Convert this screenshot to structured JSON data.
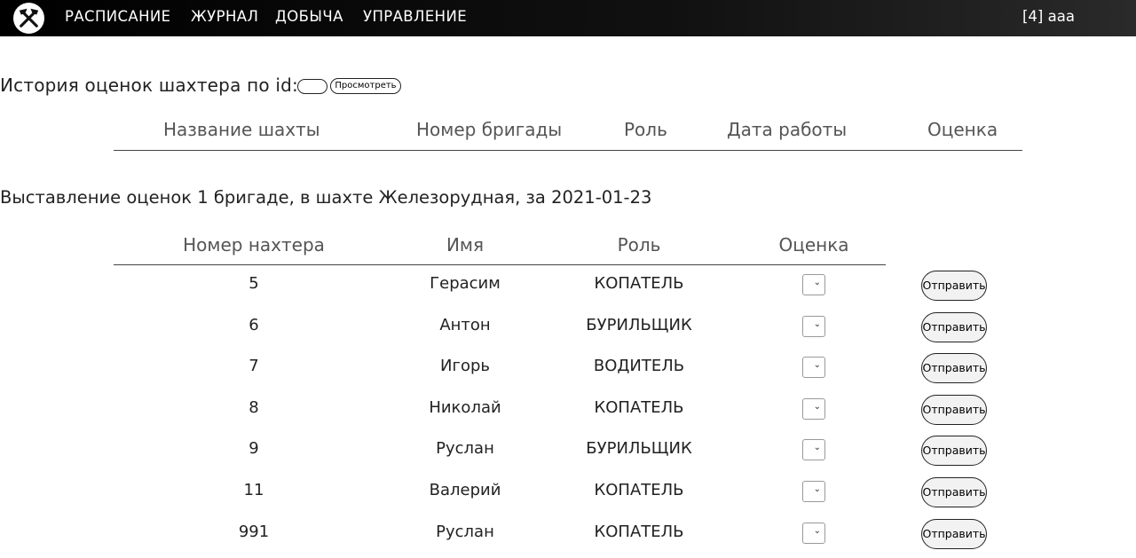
{
  "nav": {
    "items": [
      "РАСПИСАНИЕ",
      "ЖУРНАЛ",
      "ДОБЫЧА",
      "УПРАВЛЕНИЕ"
    ],
    "user": "[4] aaa"
  },
  "history": {
    "label": "История оценок шахтера по id:",
    "input_value": "",
    "button_label": "Просмотреть",
    "columns": [
      "Название шахты",
      "Номер бригады",
      "Роль",
      "Дата работы",
      "Оценка"
    ]
  },
  "grading": {
    "title": "Выставление оценок 1 бригаде, в шахте Железорудная, за 2021-01-23",
    "columns": [
      "Номер нахтера",
      "Имя",
      "Роль",
      "Оценка"
    ],
    "rows": [
      {
        "id": "5",
        "name": "Герасим",
        "role": "КОПАТЕЛЬ",
        "grade": "",
        "button": "Отправить"
      },
      {
        "id": "6",
        "name": "Антон",
        "role": "БУРИЛЬЩИК",
        "grade": "",
        "button": "Отправить"
      },
      {
        "id": "7",
        "name": "Игорь",
        "role": "ВОДИТЕЛЬ",
        "grade": "",
        "button": "Отправить"
      },
      {
        "id": "8",
        "name": "Николай",
        "role": "КОПАТЕЛЬ",
        "grade": "",
        "button": "Отправить"
      },
      {
        "id": "9",
        "name": "Руслан",
        "role": "БУРИЛЬЩИК",
        "grade": "",
        "button": "Отправить"
      },
      {
        "id": "11",
        "name": "Валерий",
        "role": "КОПАТЕЛЬ",
        "grade": "",
        "button": "Отправить"
      },
      {
        "id": "991",
        "name": "Руслан",
        "role": "КОПАТЕЛЬ",
        "grade": "",
        "button": "Отправить"
      }
    ]
  }
}
